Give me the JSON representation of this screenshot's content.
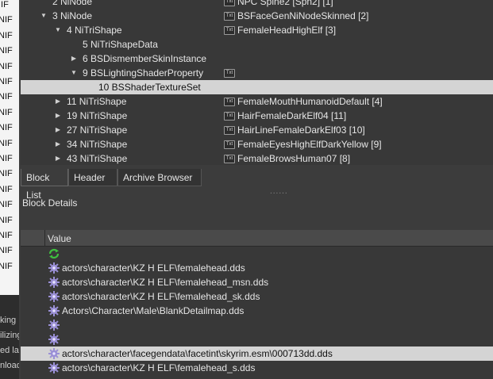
{
  "left_strip": {
    "labels": [
      "IIF",
      "NIF",
      "NIF",
      "NIF",
      "NIF",
      "NIF",
      "NIF",
      "NIF",
      "NIF",
      "NIF",
      "NIF",
      "NIF",
      "NIF",
      "NIF",
      "NIF",
      "NIF",
      "NIF",
      "NIF"
    ],
    "dark_labels": [
      "king",
      "ilizing",
      "ed lar",
      "nload"
    ]
  },
  "tree": {
    "rows": [
      {
        "arrow": "",
        "name": "2 NiNode",
        "value": "NPC Spine2 [Spn2] [1]",
        "has_txt": true
      },
      {
        "arrow": "▼",
        "name": "3 NiNode",
        "value": "BSFaceGenNiNodeSkinned [2]",
        "has_txt": true
      },
      {
        "arrow": "▼",
        "name": "4 NiTriShape",
        "value": "FemaleHeadHighElf [3]",
        "has_txt": true
      },
      {
        "arrow": "",
        "name": "5 NiTriShapeData",
        "value": "",
        "has_txt": false
      },
      {
        "arrow": "▶",
        "name": "6 BSDismemberSkinInstance",
        "value": "",
        "has_txt": false
      },
      {
        "arrow": "▼",
        "name": "9 BSLightingShaderProperty",
        "value": "",
        "has_txt": true
      },
      {
        "arrow": "",
        "name": "10 BSShaderTextureSet",
        "value": "",
        "has_txt": false
      },
      {
        "arrow": "▶",
        "name": "11 NiTriShape",
        "value": "FemaleMouthHumanoidDefault [4]",
        "has_txt": true
      },
      {
        "arrow": "▶",
        "name": "19 NiTriShape",
        "value": "HairFemaleDarkElf04 [11]",
        "has_txt": true
      },
      {
        "arrow": "▶",
        "name": "27 NiTriShape",
        "value": "HairLineFemaleDarkElf03 [10]",
        "has_txt": true
      },
      {
        "arrow": "▶",
        "name": "34 NiTriShape",
        "value": "FemaleEyesHighElfDarkYellow [9]",
        "has_txt": true
      },
      {
        "arrow": "▶",
        "name": "43 NiTriShape",
        "value": "FemaleBrowsHuman07 [8]",
        "has_txt": true
      }
    ],
    "txt_label": "Txt"
  },
  "tabs": [
    "Block List",
    "Header",
    "Archive Browser"
  ],
  "splitter": "......",
  "block_details": {
    "title": "Block Details",
    "column_header": "Value",
    "rows": [
      {
        "icon": "green-refresh",
        "text": ""
      },
      {
        "icon": "gear",
        "text": "actors\\character\\KZ H ELF\\femalehead.dds"
      },
      {
        "icon": "gear",
        "text": "actors\\character\\KZ H ELF\\femalehead_msn.dds"
      },
      {
        "icon": "gear",
        "text": "actors\\character\\KZ H ELF\\femalehead_sk.dds"
      },
      {
        "icon": "gear",
        "text": "Actors\\Character\\Male\\BlankDetailmap.dds"
      },
      {
        "icon": "gear",
        "text": ""
      },
      {
        "icon": "gear",
        "text": ""
      },
      {
        "icon": "gear",
        "text": "actors\\character\\facegendata\\facetint\\skyrim.esm\\000713dd.dds"
      },
      {
        "icon": "gear",
        "text": "actors\\character\\KZ H ELF\\femalehead_s.dds"
      }
    ]
  },
  "colors": {
    "gear": "#9a8fd6",
    "refresh": "#3fbf3f",
    "selection": "#d4d4d4"
  }
}
